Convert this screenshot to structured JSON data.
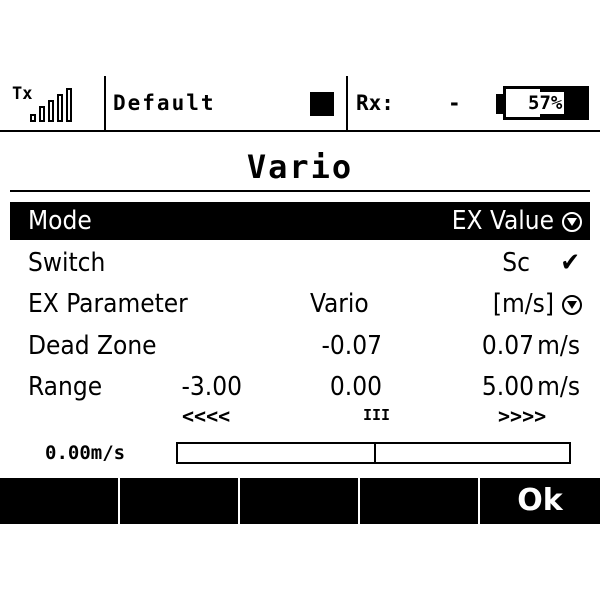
{
  "status_bar": {
    "tx_label": "Tx",
    "model_name": "Default",
    "rx_label": "Rx:",
    "rx_value": "-",
    "battery_percent": "57%",
    "battery_level": 0.57
  },
  "screen": {
    "title": "Vario"
  },
  "rows": {
    "mode": {
      "label": "Mode",
      "value": "EX Value"
    },
    "switch": {
      "label": "Switch",
      "value": "Sc",
      "check": "✔"
    },
    "ex_parameter": {
      "label": "EX Parameter",
      "value": "Vario",
      "unit": "[m/s]"
    },
    "dead_zone": {
      "label": "Dead Zone",
      "min": "-0.07",
      "max": "0.07",
      "unit": "m/s"
    },
    "range": {
      "label": "Range",
      "min": "-3.00",
      "mid": "0.00",
      "max": "5.00",
      "unit": "m/s"
    }
  },
  "indicators": {
    "down": "<<<<",
    "zero": "III",
    "up": ">>>>"
  },
  "readout": {
    "value": "0.00m/s",
    "level": 0.5
  },
  "softkeys": [
    "",
    "",
    "",
    "",
    "Ok"
  ]
}
